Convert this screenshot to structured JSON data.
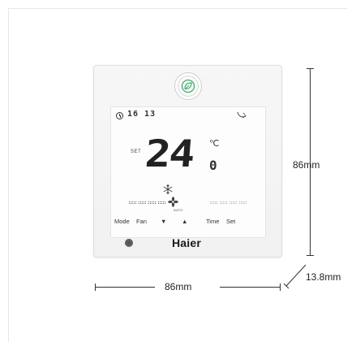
{
  "device": {
    "time_display": "16 13",
    "set_label": "SET",
    "temperature": "24",
    "temperature_decimal": "0",
    "unit": "℃",
    "fan_mode_label": "AUTO",
    "buttons": [
      "Mode",
      "Fan",
      "▼",
      "▲",
      "Time",
      "Set"
    ],
    "brand": "Haier",
    "eco_color": "#3fae6b"
  },
  "dimensions": {
    "height": "86mm",
    "width": "86mm",
    "depth": "13.8mm"
  }
}
